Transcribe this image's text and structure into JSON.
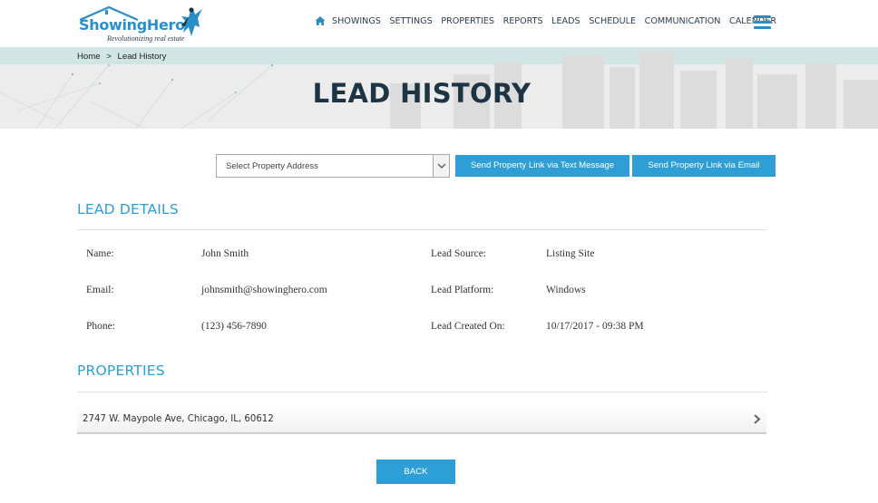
{
  "brand": {
    "name": "ShowingHero",
    "tagline": "Revolutionizing real estate",
    "accent": "#2e9fd6",
    "dark": "#1d3444"
  },
  "nav": {
    "home_icon": "home-icon",
    "items": [
      "SHOWINGS",
      "SETTINGS",
      "PROPERTIES",
      "REPORTS",
      "LEADS",
      "SCHEDULE",
      "COMMUNICATION",
      "CALENDER"
    ],
    "menu_icon": "hamburger-menu-icon"
  },
  "breadcrumb": {
    "home": "Home",
    "separator": ">",
    "current": "Lead History"
  },
  "page": {
    "title": "LEAD HISTORY"
  },
  "actions": {
    "select_value": "Select Property Address",
    "send_text_label": "Send Property Link via Text Message",
    "send_email_label": "Send Property Link via Email"
  },
  "lead_details": {
    "heading": "LEAD DETAILS",
    "fields": [
      {
        "label": "Name:",
        "value": "John Smith"
      },
      {
        "label": "Email:",
        "value": "johnsmith@showinghero.com"
      },
      {
        "label": "Phone:",
        "value": "(123) 456-7890"
      },
      {
        "label": "Lead Source:",
        "value": "Listing Site"
      },
      {
        "label": "Lead Platform:",
        "value": "Windows"
      },
      {
        "label": "Lead Created On:",
        "value": "10/17/2017 - 09:38 PM"
      }
    ]
  },
  "properties": {
    "heading": "PROPERTIES",
    "items": [
      {
        "address": "2747 W. Maypole Ave, Chicago, IL, 60612"
      }
    ]
  },
  "back_label": "BACK"
}
